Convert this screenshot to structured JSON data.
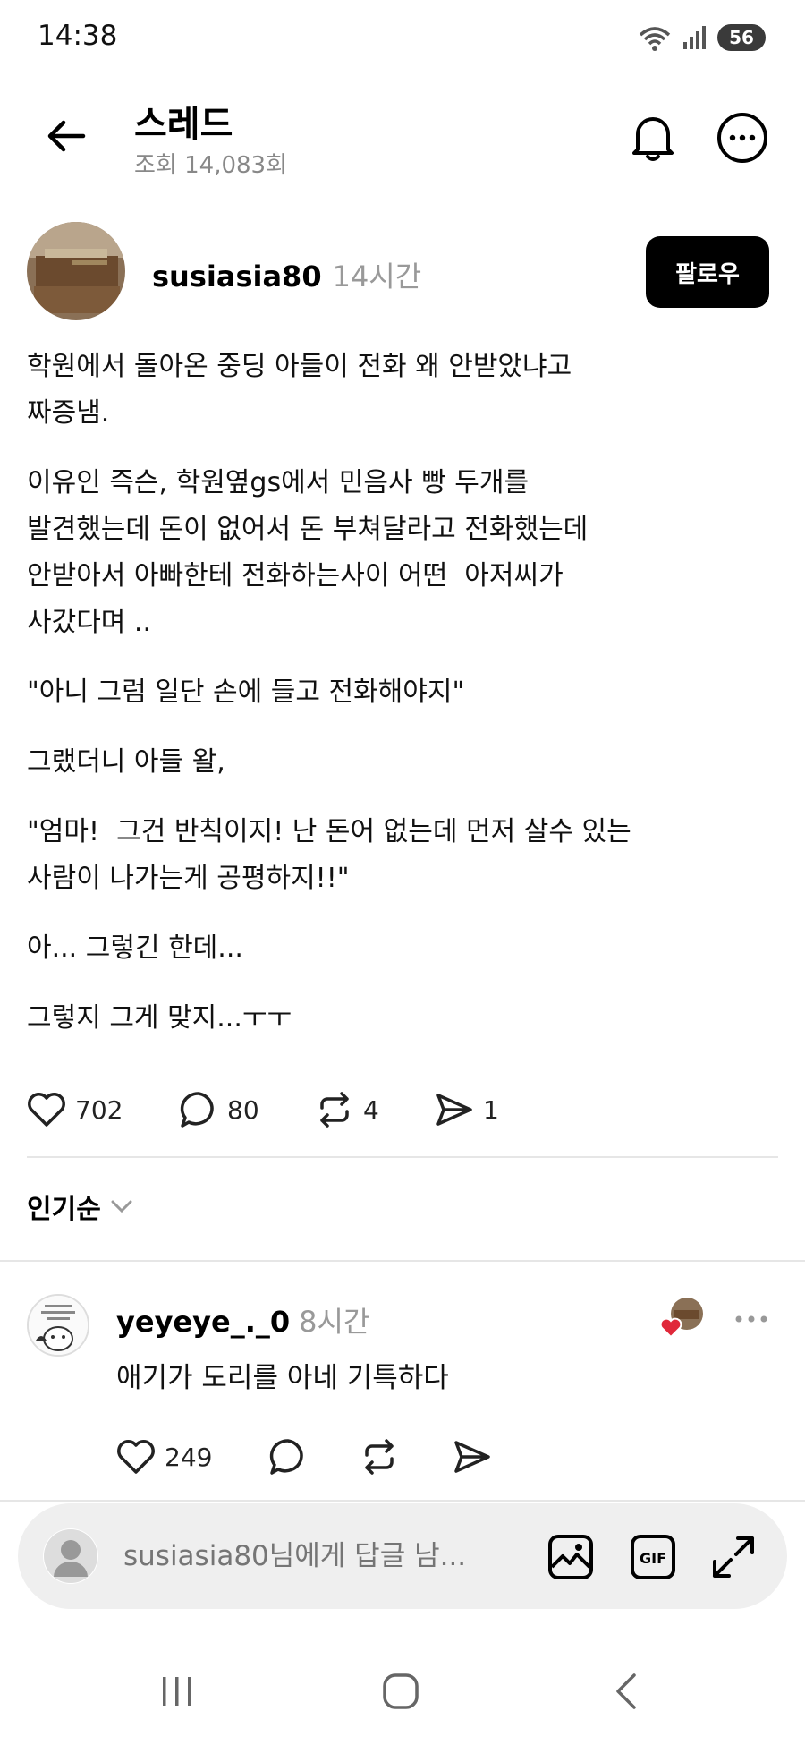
{
  "status_bar": {
    "time": "14:38",
    "battery": "56"
  },
  "header": {
    "title": "스레드",
    "views": "조회 14,083회"
  },
  "post": {
    "author": "susiasia80",
    "time": "14시간",
    "follow_label": "팔로우",
    "paragraphs": [
      "학원에서 돌아온 중딩 아들이 전화 왜 안받았냐고\n짜증냄.",
      "이유인 즉슨, 학원옆gs에서 민음사 빵 두개를\n발견했는데 돈이 없어서 돈 부쳐달라고 전화했는데\n안받아서 아빠한테 전화하는사이 어떤  아저씨가\n사갔다며 ..",
      "\"아니 그럼 일단 손에 들고 전화해야지\"",
      "그랬더니 아들 왈,",
      "\"엄마!  그건 반칙이지! 난 돈어 없는데 먼저 살수 있는\n사람이 나가는게 공평하지!!\"",
      "아... 그렇긴 한데...",
      "그렇지 그게 맞지...ㅜㅜ"
    ],
    "likes": "702",
    "comments": "80",
    "reposts": "4",
    "shares": "1"
  },
  "sort": {
    "label": "인기순"
  },
  "comment": {
    "user": "yeyeye_._0",
    "time": "8시간",
    "text": "애기가 도리를 아네 기특하다",
    "likes": "249"
  },
  "reply": {
    "placeholder": "susiasia80님에게 답글 남..."
  },
  "icons": {
    "back": "arrow-left-icon",
    "bell": "bell-icon",
    "more": "more-circle-icon",
    "heart": "heart-icon",
    "comment": "comment-bubble-icon",
    "repost": "repost-icon",
    "share": "send-icon",
    "image": "image-icon",
    "gif": "gif-icon",
    "expand": "expand-icon"
  },
  "colors": {
    "follow_bg": "#000000",
    "heart_red": "#e0283a",
    "muted_text": "#999999",
    "reply_bg": "#efefef"
  }
}
